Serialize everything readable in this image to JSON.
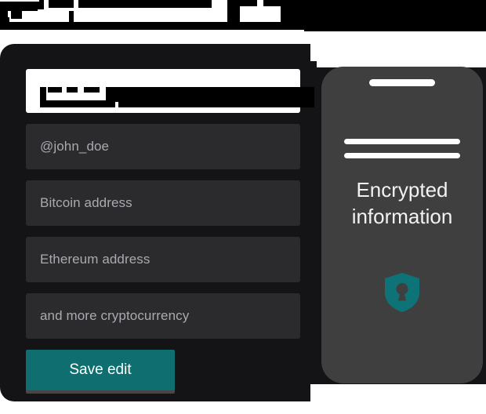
{
  "header": {
    "redacted": true,
    "note": "heading text blacked out"
  },
  "form": {
    "fields": [
      {
        "name": "name-field",
        "value": "",
        "placeholder": "",
        "state": "focused-redacted"
      },
      {
        "name": "username-field",
        "value": "",
        "placeholder": "@john_doe",
        "state": "empty"
      },
      {
        "name": "bitcoin-field",
        "value": "",
        "placeholder": "Bitcoin address",
        "state": "empty"
      },
      {
        "name": "ethereum-field",
        "value": "",
        "placeholder": "Ethereum address",
        "state": "empty"
      },
      {
        "name": "other-crypto-field",
        "value": "",
        "placeholder": "and more cryptocurrency",
        "state": "empty"
      }
    ],
    "save_label": "Save edit"
  },
  "phone": {
    "title_line_1": "Encrypted",
    "title_line_2": "information",
    "icon": "shield-lock-icon"
  },
  "colors": {
    "accent": "#0e6e70",
    "card_bg": "#141416",
    "input_bg": "#2b2b2e",
    "phone_bg": "#3f3f3f",
    "placeholder": "#a9aab0",
    "page_bg": "#ffffff"
  }
}
